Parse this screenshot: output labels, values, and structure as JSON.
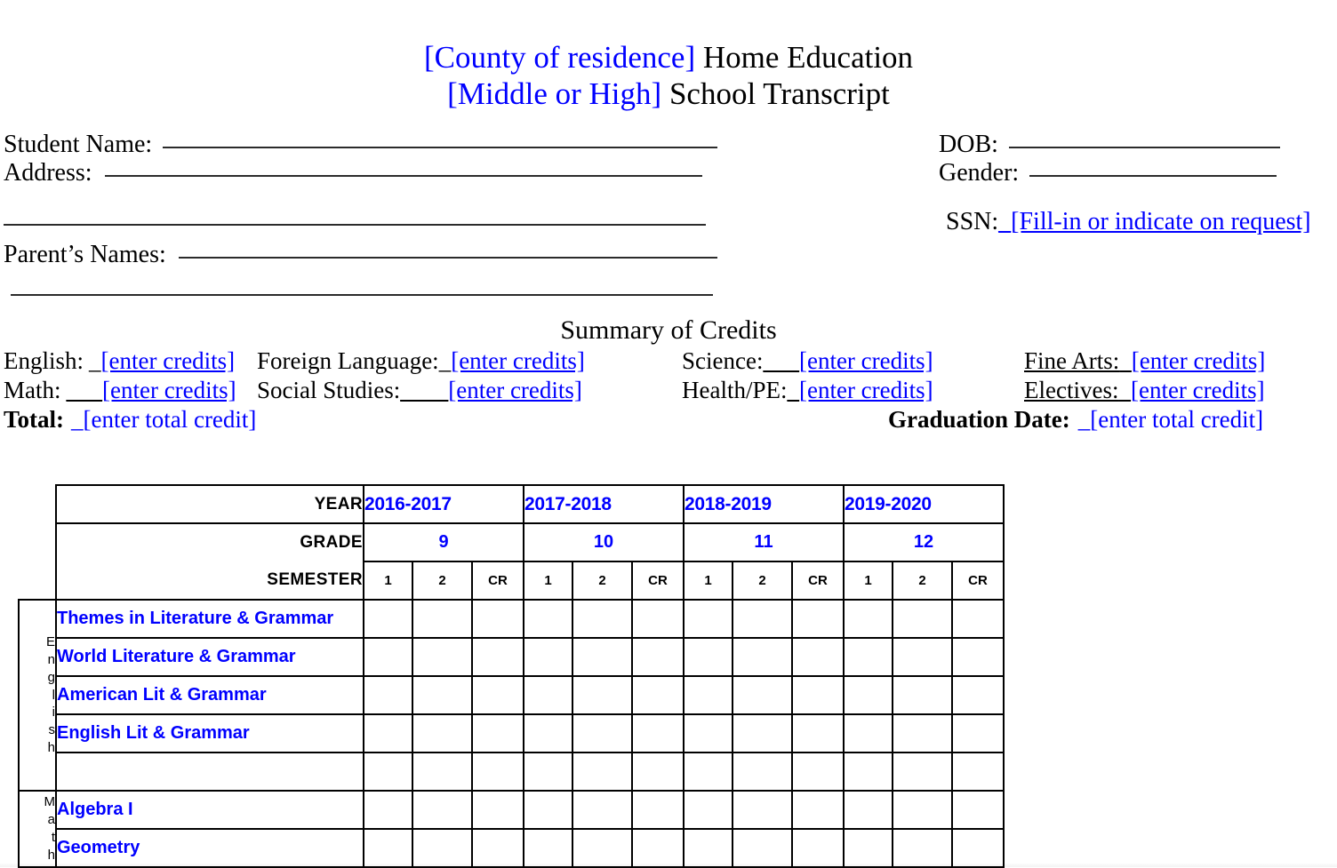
{
  "title": {
    "line1_placeholder": "[County of residence]",
    "line1_rest": " Home Education",
    "line2_placeholder": "[Middle or High]",
    "line2_rest": " School Transcript"
  },
  "info": {
    "left": {
      "student_name_label": "Student Name:",
      "address_label": "Address:",
      "parents_names_label": "Parent’s Names:"
    },
    "right": {
      "dob_label": "DOB:",
      "gender_label": "Gender:",
      "ssn_label": "SSN:",
      "ssn_underscore": "_",
      "ssn_value": "[Fill-in or indicate on request]"
    }
  },
  "summary": {
    "heading": "Summary of Credits",
    "items": [
      {
        "label": "English:",
        "underscores": "_",
        "value": "[enter credits]"
      },
      {
        "label": "Foreign Language:",
        "underscores": "_",
        "value": "[enter credits]"
      },
      {
        "label": "Science:",
        "underscores": "___",
        "value": "[enter credits]"
      },
      {
        "label": "Fine Arts:",
        "underscores": "_",
        "value": "[enter credits]"
      },
      {
        "label": "Math:",
        "underscores": "___",
        "value": "[enter credits]"
      },
      {
        "label": "Social Studies:",
        "underscores": "____",
        "value": "[enter credits]"
      },
      {
        "label": "Health/PE:",
        "underscores": "_",
        "value": "[enter credits]"
      },
      {
        "label": "Electives:",
        "underscores": "_",
        "value": "[enter credits]"
      }
    ],
    "total_label": "Total:",
    "total_underscore": "_",
    "total_value": "[enter total credit]",
    "graduation_label": "Graduation Date:",
    "graduation_underscore": "_",
    "graduation_value": "[enter total credit]"
  },
  "table": {
    "row_labels": {
      "year": "YEAR",
      "grade": "GRADE",
      "semester": "SEMESTER"
    },
    "years": [
      "2016-2017",
      "2017-2018",
      "2018-2019",
      "2019-2020"
    ],
    "grades": [
      "9",
      "10",
      "11",
      "12"
    ],
    "semester_columns": [
      "1",
      "2",
      "CR"
    ],
    "subjects": [
      {
        "name": "English",
        "letters": [
          "E",
          "n",
          "g",
          "l",
          "i",
          "s",
          "h"
        ]
      },
      {
        "name": "Math",
        "letters": [
          "M",
          "a",
          "t",
          "h"
        ]
      }
    ],
    "courses": [
      "Themes in Literature & Grammar",
      "World Literature & Grammar",
      "American Lit & Grammar",
      "English Lit & Grammar",
      "",
      "Algebra I",
      "Geometry"
    ]
  },
  "colors": {
    "placeholder_blue": "#0000ff",
    "text_black": "#000000",
    "rule_gray": "#2b2b2b"
  }
}
